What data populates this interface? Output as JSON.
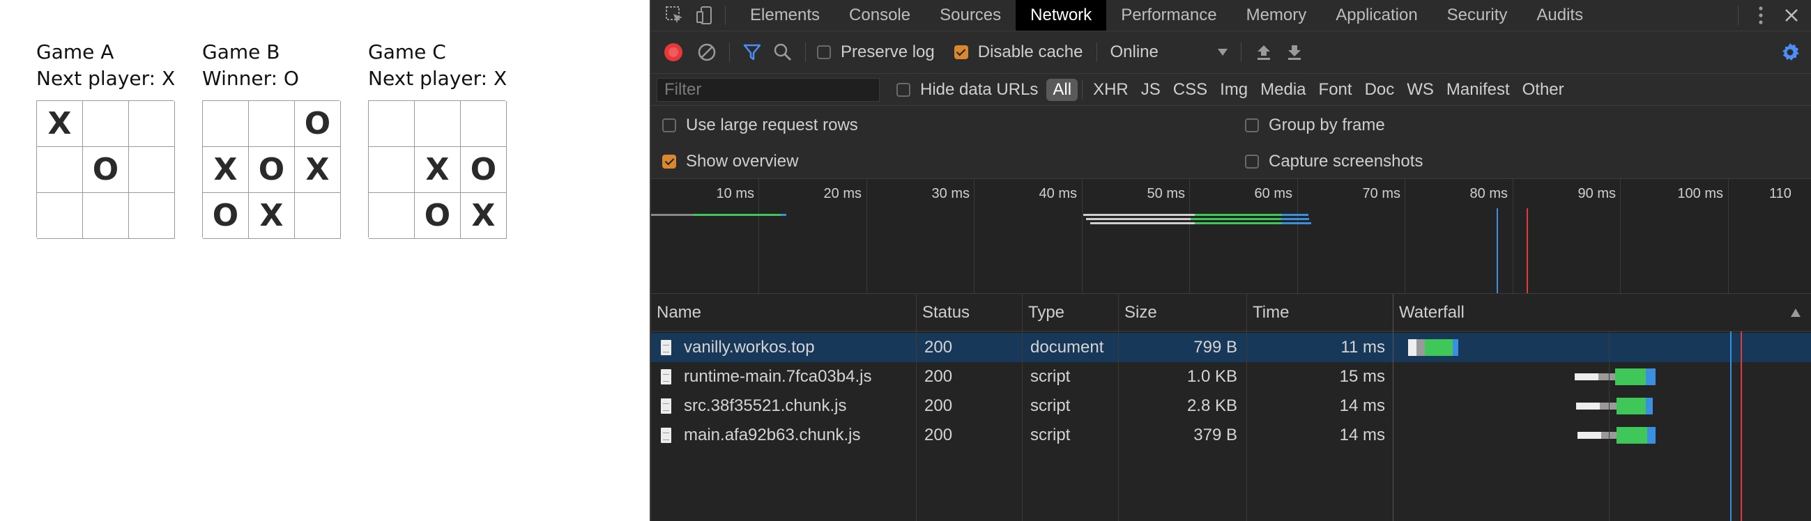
{
  "games": [
    {
      "title": "Game A",
      "status": "Next player: X",
      "cells": [
        "X",
        "",
        "",
        "",
        "O",
        "",
        "",
        "",
        ""
      ]
    },
    {
      "title": "Game B",
      "status": "Winner: O",
      "cells": [
        "",
        "",
        "O",
        "X",
        "O",
        "X",
        "O",
        "X",
        ""
      ]
    },
    {
      "title": "Game C",
      "status": "Next player: X",
      "cells": [
        "",
        "",
        "",
        "",
        "X",
        "O",
        "",
        "O",
        "X"
      ]
    }
  ],
  "devtools": {
    "tabs": [
      "Elements",
      "Console",
      "Sources",
      "Network",
      "Performance",
      "Memory",
      "Application",
      "Security",
      "Audits"
    ],
    "active_tab": "Network",
    "toolbar": {
      "preserve_log": "Preserve log",
      "disable_cache": "Disable cache",
      "throttle": "Online"
    },
    "filter": {
      "placeholder": "Filter",
      "hide_data_urls": "Hide data URLs",
      "types": [
        "All",
        "XHR",
        "JS",
        "CSS",
        "Img",
        "Media",
        "Font",
        "Doc",
        "WS",
        "Manifest",
        "Other"
      ],
      "active_type": "All"
    },
    "settings": {
      "large_rows": "Use large request rows",
      "show_overview": "Show overview",
      "group_by_frame": "Group by frame",
      "capture_screenshots": "Capture screenshots"
    },
    "overview_ticks": [
      "10 ms",
      "20 ms",
      "30 ms",
      "40 ms",
      "50 ms",
      "60 ms",
      "70 ms",
      "80 ms",
      "90 ms",
      "100 ms",
      "110"
    ],
    "columns": {
      "name": "Name",
      "status": "Status",
      "type": "Type",
      "size": "Size",
      "time": "Time",
      "waterfall": "Waterfall"
    },
    "requests": [
      {
        "name": "vanilly.workos.top",
        "status": "200",
        "type": "document",
        "size": "799 B",
        "time": "11 ms"
      },
      {
        "name": "runtime-main.7fca03b4.js",
        "status": "200",
        "type": "script",
        "size": "1.0 KB",
        "time": "15 ms"
      },
      {
        "name": "src.38f35521.chunk.js",
        "status": "200",
        "type": "script",
        "size": "2.8 KB",
        "time": "14 ms"
      },
      {
        "name": "main.afa92b63.chunk.js",
        "status": "200",
        "type": "script",
        "size": "379 B",
        "time": "14 ms"
      }
    ],
    "colors": {
      "accent_blue": "#4c8df6",
      "record_red": "#e5383b",
      "checkbox_orange": "#d9882f",
      "selected_row": "#183859",
      "waiting_green": "#3fc75a",
      "download_blue": "#3b8fe0"
    }
  }
}
